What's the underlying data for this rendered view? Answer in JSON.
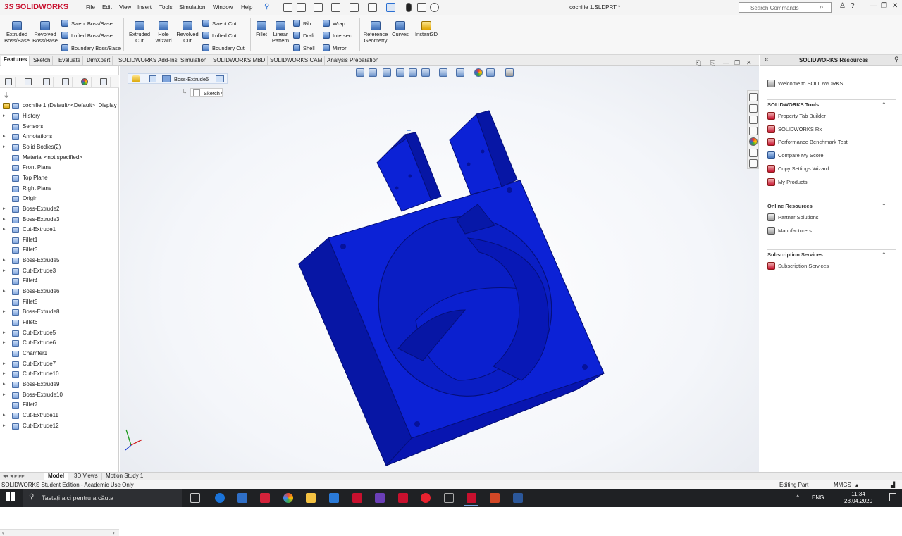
{
  "app": {
    "brand": "SOLIDWORKS",
    "doc_title": "cochilie 1.SLDPRT *"
  },
  "menu": [
    "File",
    "Edit",
    "View",
    "Insert",
    "Tools",
    "Simulation",
    "Window",
    "Help"
  ],
  "search": {
    "placeholder": "Search Commands"
  },
  "window_buttons": {
    "help": "?",
    "minimize": "—",
    "restore": "❐",
    "close": "✕"
  },
  "commands": {
    "extruded_boss": "Extruded Boss/Base",
    "revolved_boss": "Revolved Boss/Base",
    "swept_boss": "Swept Boss/Base",
    "lofted_boss": "Lofted Boss/Base",
    "boundary_boss": "Boundary Boss/Base",
    "extruded_cut": "Extruded Cut",
    "hole_wizard": "Hole Wizard",
    "revolved_cut": "Revolved Cut",
    "swept_cut": "Swept Cut",
    "lofted_cut": "Lofted Cut",
    "boundary_cut": "Boundary Cut",
    "fillet": "Fillet",
    "linear_pattern": "Linear Pattern",
    "rib": "Rib",
    "draft": "Draft",
    "shell": "Shell",
    "wrap": "Wrap",
    "intersect": "Intersect",
    "mirror": "Mirror",
    "reference_geometry": "Reference Geometry",
    "curves": "Curves",
    "instant3d": "Instant3D"
  },
  "tabs": [
    "Features",
    "Sketch",
    "Evaluate",
    "DimXpert",
    "SOLIDWORKS Add-Ins",
    "Simulation",
    "SOLIDWORKS MBD",
    "SOLIDWORKS CAM",
    "Analysis Preparation"
  ],
  "feature_tree": {
    "root": "cochilie 1  (Default<<Default>_Display",
    "items": [
      {
        "label": "History",
        "expand": "▸"
      },
      {
        "label": "Sensors",
        "expand": ""
      },
      {
        "label": "Annotations",
        "expand": "▸"
      },
      {
        "label": "Solid Bodies(2)",
        "expand": "▸"
      },
      {
        "label": "Material <not specified>",
        "expand": ""
      },
      {
        "label": "Front Plane",
        "expand": ""
      },
      {
        "label": "Top Plane",
        "expand": ""
      },
      {
        "label": "Right Plane",
        "expand": ""
      },
      {
        "label": "Origin",
        "expand": ""
      },
      {
        "label": "Boss-Extrude2",
        "expand": "▸"
      },
      {
        "label": "Boss-Extrude3",
        "expand": "▸"
      },
      {
        "label": "Cut-Extrude1",
        "expand": "▸"
      },
      {
        "label": "Fillet1",
        "expand": ""
      },
      {
        "label": "Fillet3",
        "expand": ""
      },
      {
        "label": "Boss-Extrude5",
        "expand": "▸"
      },
      {
        "label": "Cut-Extrude3",
        "expand": "▸"
      },
      {
        "label": "Fillet4",
        "expand": ""
      },
      {
        "label": "Boss-Extrude6",
        "expand": "▸"
      },
      {
        "label": "Fillet5",
        "expand": ""
      },
      {
        "label": "Boss-Extrude8",
        "expand": "▸"
      },
      {
        "label": "Fillet6",
        "expand": ""
      },
      {
        "label": "Cut-Extrude5",
        "expand": "▸"
      },
      {
        "label": "Cut-Extrude6",
        "expand": "▸"
      },
      {
        "label": "Chamfer1",
        "expand": ""
      },
      {
        "label": "Cut-Extrude7",
        "expand": "▸"
      },
      {
        "label": "Cut-Extrude10",
        "expand": "▸"
      },
      {
        "label": "Boss-Extrude9",
        "expand": "▸"
      },
      {
        "label": "Boss-Extrude10",
        "expand": "▸"
      },
      {
        "label": "Fillet7",
        "expand": ""
      },
      {
        "label": "Cut-Extrude11",
        "expand": "▸"
      },
      {
        "label": "Cut-Extrude12",
        "expand": "▸"
      }
    ]
  },
  "breadcrumb": {
    "feature": "Boss-Extrude5",
    "sketch": "Sketch7"
  },
  "task_pane": {
    "title": "SOLIDWORKS Resources",
    "welcome": "Welcome to SOLIDWORKS",
    "sections": [
      {
        "title": "SOLIDWORKS Tools",
        "items": [
          "Property Tab Builder",
          "SOLIDWORKS Rx",
          "Performance Benchmark Test",
          "Compare My Score",
          "Copy Settings Wizard",
          "My Products"
        ]
      },
      {
        "title": "Online Resources",
        "items": [
          "Partner Solutions",
          "Manufacturers"
        ]
      },
      {
        "title": "Subscription Services",
        "items": [
          "Subscription Services"
        ]
      }
    ]
  },
  "bottom_tabs": [
    "Model",
    "3D Views",
    "Motion Study 1"
  ],
  "status": {
    "left": "SOLIDWORKS Student Edition - Academic Use Only",
    "mode": "Editing Part",
    "units": "MMGS"
  },
  "taskbar": {
    "search_placeholder": "Tastați aici pentru a căuta",
    "lang": "ENG",
    "time": "11:34",
    "date": "28.04.2020"
  },
  "colors": {
    "part": "#0a1fc9",
    "part_edge": "#050f7a",
    "brand": "#c8102e",
    "selection": "#2a6fd2"
  }
}
